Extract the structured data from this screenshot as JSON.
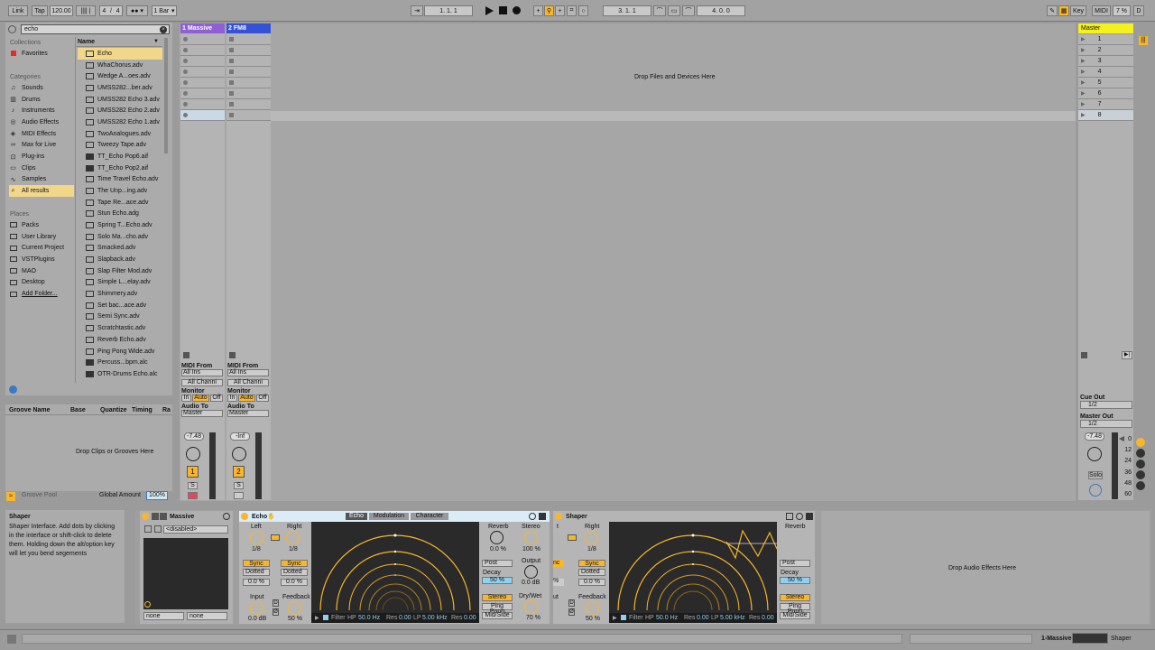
{
  "transport": {
    "link": "Link",
    "tap": "Tap",
    "tempo": "120.00",
    "sig_num": "4",
    "sig_den": "4",
    "quant": "1 Bar",
    "arr_pos": "1.   1.   1",
    "loop_start": "3.   1.   1",
    "loop_len": "4.   0.   0",
    "key": "Key",
    "midi": "MIDI",
    "cpu": "7 %",
    "d": "D"
  },
  "browser": {
    "search": "echo",
    "collections_header": "Collections",
    "favorites": "Favorites",
    "categories_header": "Categories",
    "categories": [
      {
        "label": "Sounds",
        "icon": "sounds-icon"
      },
      {
        "label": "Drums",
        "icon": "drums-icon"
      },
      {
        "label": "Instruments",
        "icon": "instruments-icon"
      },
      {
        "label": "Audio Effects",
        "icon": "audio-effects-icon"
      },
      {
        "label": "MIDI Effects",
        "icon": "midi-effects-icon"
      },
      {
        "label": "Max for Live",
        "icon": "max-for-live-icon"
      },
      {
        "label": "Plug-ins",
        "icon": "plugins-icon"
      },
      {
        "label": "Clips",
        "icon": "clips-icon"
      },
      {
        "label": "Samples",
        "icon": "samples-icon"
      },
      {
        "label": "All results",
        "icon": "search-icon"
      }
    ],
    "places_header": "Places",
    "places": [
      "Packs",
      "User Library",
      "Current Project",
      "VSTPlugins",
      "MAO",
      "Desktop",
      "Add Folder..."
    ],
    "name_header": "Name",
    "results": [
      "Echo",
      "WhaChorus.adv",
      "Wedge A...oes.adv",
      "UMSS282...ber.adv",
      "UMSS282 Echo 3.adv",
      "UMSS282 Echo 2.adv",
      "UMSS282 Echo 1.adv",
      "TwoAnalogues.adv",
      "Tweezy Tape.adv",
      "TT_Echo Pop6.aif",
      "TT_Echo Pop2.aif",
      "Time Travel Echo.adv",
      "The Unp...ing.adv",
      "Tape Re...ace.adv",
      "Stun Echo.adg",
      "Spring T...Echo.adv",
      "Solo Ma...cho.adv",
      "Smacked.adv",
      "Slapback.adv",
      "Slap Filter Mod.adv",
      "Simple L...elay.adv",
      "Shimmery.adv",
      "Set bac...ace.adv",
      "Semi Sync.adv",
      "Scratchtastic.adv",
      "Reverb Echo.adv",
      "Ping Pong Wide.adv",
      "Percuss...bpm.alc",
      "OTR-Drums Echo.alc"
    ]
  },
  "groove": {
    "cols": [
      "Groove Name",
      "Base",
      "Quantize",
      "Timing",
      "Ra"
    ],
    "drop": "Drop Clips or Grooves Here",
    "pool": "Groove Pool",
    "global_amount_label": "Global Amount",
    "global_amount": "100%"
  },
  "tracks": [
    {
      "name": "1 Massive",
      "color": "#8f5fd6",
      "vol": "-7.48",
      "num": "1",
      "midi_from": "MIDI From",
      "in": "All Ins",
      "chan": "All Channi",
      "monitor": "Monitor",
      "mon_in": "In",
      "mon_auto": "Auto",
      "mon_off": "Off",
      "audio_to": "Audio To",
      "dest": "Master",
      "solo": "S"
    },
    {
      "name": "2 FM8",
      "color": "#3352d6",
      "vol": "-Inf",
      "num": "2",
      "midi_from": "MIDI From",
      "in": "All Ins",
      "chan": "All Channi",
      "monitor": "Monitor",
      "mon_in": "In",
      "mon_auto": "Auto",
      "mon_off": "Off",
      "audio_to": "Audio To",
      "dest": "Master",
      "solo": "S"
    }
  ],
  "session": {
    "drop": "Drop Files and Devices Here"
  },
  "master": {
    "name": "Master",
    "scenes": [
      "1",
      "2",
      "3",
      "4",
      "5",
      "6",
      "7",
      "8"
    ],
    "cue_out": "Cue Out",
    "cue_val": "1/2",
    "master_out": "Master Out",
    "master_val": "1/2",
    "vol": "-7.48",
    "solo": "Solo",
    "meter_ticks": [
      "0",
      "12",
      "24",
      "36",
      "48",
      "60"
    ]
  },
  "info": {
    "title": "Shaper",
    "text": "Shaper Interface. Add dots by clicking in the interface or shift-click to delete them. Holding down the alt/option key will let you bend segements"
  },
  "devices": {
    "massive": {
      "name": "Massive",
      "select": "<disabled>",
      "none1": "none",
      "none2": "none"
    },
    "echo": {
      "name": "Echo",
      "tab1": "Echo",
      "tab2": "Modulation",
      "tab3": "Character",
      "left": "Left",
      "right": "Right",
      "left_val": "1/8",
      "right_val": "1/8",
      "sync": "Sync",
      "dotted": "Dotted",
      "left_off": "0.0 %",
      "right_off": "0.0 %",
      "input": "Input",
      "input_val": "0.0 dB",
      "feedback": "Feedback",
      "feedback_val": "50 %",
      "reverb": "Reverb",
      "reverb_val": "0.0 %",
      "stereo": "Stereo",
      "stereo_val": "100 %",
      "post": "Post",
      "decay": "Decay",
      "decay_val": "50 %",
      "output": "Output",
      "output_val": "0.0 dB",
      "stereo_btn": "Stereo",
      "drywet": "Dry/Wet",
      "drywet_val": "70 %",
      "pingpong": "Ping Pong",
      "midside": "Mid/Side",
      "filter": "Filter",
      "hp": "HP",
      "hp_val": "50.0 Hz",
      "res": "Res",
      "res1": "0.00",
      "lp": "LP",
      "lp_val": "5.00 kHz",
      "res2": "0.00"
    },
    "shaper": {
      "name": "Shaper",
      "reverb": "Reverb",
      "right": "Right",
      "right_val": "1/8",
      "sync": "Sync",
      "dotted": "Dotted",
      "right_off": "0.0 %",
      "feedback": "Feedback",
      "feedback_val": "50 %",
      "post": "Post",
      "decay": "Decay",
      "decay_val": "50 %",
      "stereo_btn": "Stereo",
      "pingpong": "Ping Pong",
      "midside": "Mid/Side",
      "filter": "Filter",
      "hp": "HP",
      "hp_val": "50.0 Hz",
      "res": "Res",
      "res1": "0.00",
      "lp": "LP",
      "lp_val": "5.00 kHz",
      "res2": "0.00",
      "t_label": "t",
      "ut_label": "ut",
      "nc_label": "nc",
      "pct_label": "%",
      "d_label": "D",
      "phase_label": "Ø"
    },
    "drop": "Drop Audio Effects Here"
  },
  "status": {
    "track": "1-Massive",
    "device": "Shaper"
  }
}
